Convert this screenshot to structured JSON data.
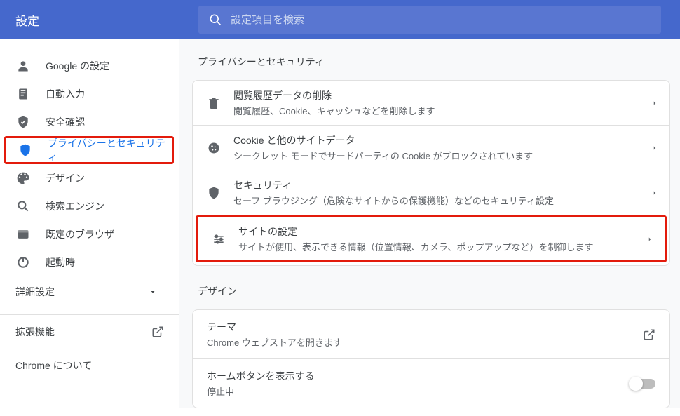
{
  "header": {
    "title": "設定",
    "search_placeholder": "設定項目を検索"
  },
  "sidebar": {
    "items": [
      {
        "label": "Google の設定"
      },
      {
        "label": "自動入力"
      },
      {
        "label": "安全確認"
      },
      {
        "label": "プライバシーとセキュリティ"
      },
      {
        "label": "デザイン"
      },
      {
        "label": "検索エンジン"
      },
      {
        "label": "既定のブラウザ"
      },
      {
        "label": "起動時"
      }
    ],
    "advanced": "詳細設定",
    "extensions": "拡張機能",
    "about": "Chrome について"
  },
  "main": {
    "section1": {
      "title": "プライバシーとセキュリティ",
      "rows": [
        {
          "title": "閲覧履歴データの削除",
          "sub": "閲覧履歴、Cookie、キャッシュなどを削除します"
        },
        {
          "title": "Cookie と他のサイトデータ",
          "sub": "シークレット モードでサードパーティの Cookie がブロックされています"
        },
        {
          "title": "セキュリティ",
          "sub": "セーフ ブラウジング（危険なサイトからの保護機能）などのセキュリティ設定"
        },
        {
          "title": "サイトの設定",
          "sub": "サイトが使用、表示できる情報（位置情報、カメラ、ポップアップなど）を制御します"
        }
      ]
    },
    "section2": {
      "title": "デザイン",
      "rows": [
        {
          "title": "テーマ",
          "sub": "Chrome ウェブストアを開きます"
        },
        {
          "title": "ホームボタンを表示する",
          "sub": "停止中"
        }
      ]
    }
  }
}
